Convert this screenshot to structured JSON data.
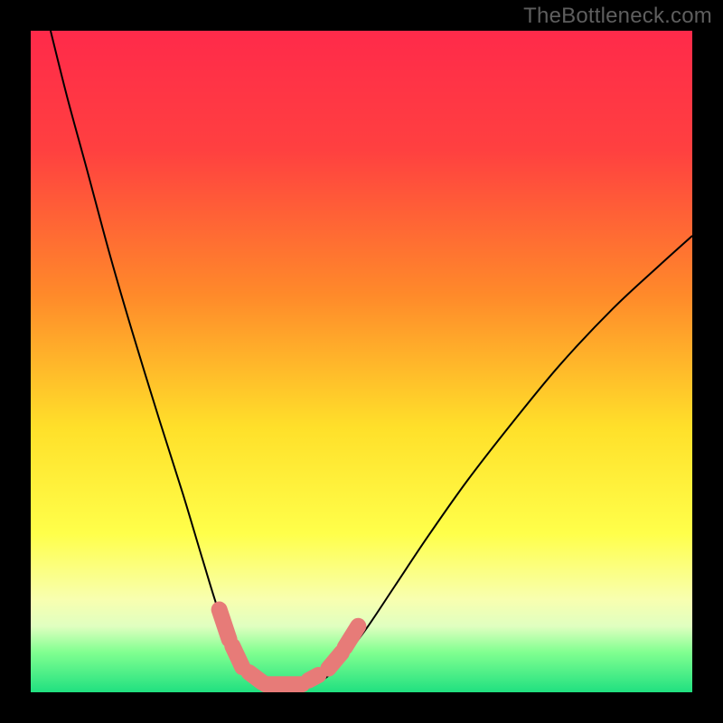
{
  "watermark": "TheBottleneck.com",
  "chart_data": {
    "type": "line",
    "title": "",
    "xlabel": "",
    "ylabel": "",
    "xlim": [
      0,
      100
    ],
    "ylim": [
      0,
      100
    ],
    "gradient_stops": [
      {
        "offset": 0,
        "color": "#ff2a4a"
      },
      {
        "offset": 18,
        "color": "#ff4040"
      },
      {
        "offset": 40,
        "color": "#ff8a2a"
      },
      {
        "offset": 60,
        "color": "#ffe02a"
      },
      {
        "offset": 76,
        "color": "#ffff4a"
      },
      {
        "offset": 86,
        "color": "#f8ffb0"
      },
      {
        "offset": 90,
        "color": "#e0ffc0"
      },
      {
        "offset": 94,
        "color": "#80ff90"
      },
      {
        "offset": 100,
        "color": "#20e080"
      }
    ],
    "curve": [
      {
        "x": 3.0,
        "y": 100.0
      },
      {
        "x": 5.5,
        "y": 90.0
      },
      {
        "x": 8.5,
        "y": 79.0
      },
      {
        "x": 12.0,
        "y": 66.0
      },
      {
        "x": 15.5,
        "y": 54.0
      },
      {
        "x": 19.5,
        "y": 41.0
      },
      {
        "x": 23.0,
        "y": 30.0
      },
      {
        "x": 26.0,
        "y": 20.0
      },
      {
        "x": 28.5,
        "y": 12.0
      },
      {
        "x": 31.0,
        "y": 6.0
      },
      {
        "x": 33.0,
        "y": 2.5
      },
      {
        "x": 35.0,
        "y": 1.0
      },
      {
        "x": 38.0,
        "y": 0.5
      },
      {
        "x": 41.0,
        "y": 0.6
      },
      {
        "x": 44.0,
        "y": 1.8
      },
      {
        "x": 46.0,
        "y": 3.5
      },
      {
        "x": 48.0,
        "y": 6.0
      },
      {
        "x": 51.0,
        "y": 10.0
      },
      {
        "x": 55.0,
        "y": 16.0
      },
      {
        "x": 60.0,
        "y": 23.5
      },
      {
        "x": 66.0,
        "y": 32.0
      },
      {
        "x": 73.0,
        "y": 41.0
      },
      {
        "x": 80.0,
        "y": 49.5
      },
      {
        "x": 88.0,
        "y": 58.0
      },
      {
        "x": 95.0,
        "y": 64.5
      },
      {
        "x": 100.0,
        "y": 69.0
      }
    ],
    "markers": [
      {
        "x1": 28.5,
        "y1": 12.5,
        "x2": 30.0,
        "y2": 8.0
      },
      {
        "x1": 30.5,
        "y1": 7.0,
        "x2": 32.0,
        "y2": 3.8
      },
      {
        "x1": 33.0,
        "y1": 3.0,
        "x2": 35.0,
        "y2": 1.5
      },
      {
        "x1": 35.5,
        "y1": 1.2,
        "x2": 41.0,
        "y2": 1.2
      },
      {
        "x1": 42.0,
        "y1": 1.8,
        "x2": 43.5,
        "y2": 2.6
      },
      {
        "x1": 45.0,
        "y1": 3.6,
        "x2": 47.0,
        "y2": 6.0
      },
      {
        "x1": 47.5,
        "y1": 6.8,
        "x2": 49.5,
        "y2": 10.0
      }
    ]
  }
}
